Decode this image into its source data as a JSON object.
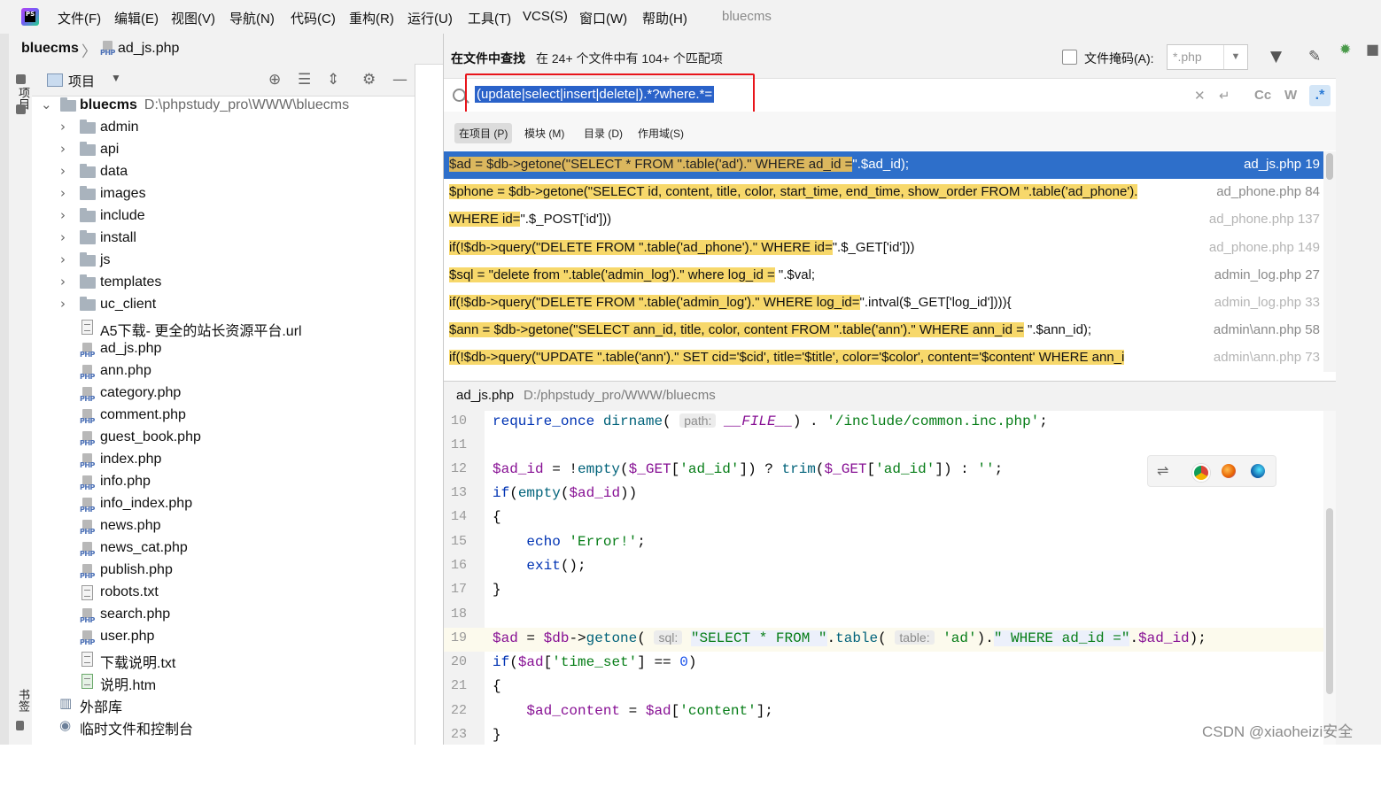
{
  "menubar": {
    "logo_text": "PS",
    "items": [
      "文件(F)",
      "编辑(E)",
      "视图(V)",
      "导航(N)",
      "代码(C)",
      "重构(R)",
      "运行(U)",
      "工具(T)",
      "VCS(S)",
      "窗口(W)",
      "帮助(H)"
    ],
    "window_title": "bluecms"
  },
  "navbar": {
    "root": "bluecms",
    "separator": "〉",
    "file": "ad_js.php"
  },
  "left_tools": {
    "project_tab": "项目",
    "bookmarks_tab": "书签"
  },
  "project": {
    "title": "项目",
    "root": {
      "name": "bluecms",
      "path": "D:\\phpstudy_pro\\WWW\\bluecms"
    },
    "folders": [
      "admin",
      "api",
      "data",
      "images",
      "include",
      "install",
      "js",
      "templates",
      "uc_client"
    ],
    "files": [
      {
        "name": "A5下载- 更全的站长资源平台.url",
        "type": "text"
      },
      {
        "name": "ad_js.php",
        "type": "php"
      },
      {
        "name": "ann.php",
        "type": "php"
      },
      {
        "name": "category.php",
        "type": "php"
      },
      {
        "name": "comment.php",
        "type": "php"
      },
      {
        "name": "guest_book.php",
        "type": "php"
      },
      {
        "name": "index.php",
        "type": "php"
      },
      {
        "name": "info.php",
        "type": "php"
      },
      {
        "name": "info_index.php",
        "type": "php"
      },
      {
        "name": "news.php",
        "type": "php"
      },
      {
        "name": "news_cat.php",
        "type": "php"
      },
      {
        "name": "publish.php",
        "type": "php"
      },
      {
        "name": "robots.txt",
        "type": "text"
      },
      {
        "name": "search.php",
        "type": "php"
      },
      {
        "name": "user.php",
        "type": "php"
      },
      {
        "name": "下载说明.txt",
        "type": "text"
      },
      {
        "name": "说明.htm",
        "type": "html"
      }
    ],
    "external_libs": "外部库",
    "scratches": "临时文件和控制台"
  },
  "find": {
    "title": "在文件中查找",
    "summary": "在 24+ 个文件中有 104+ 个匹配项",
    "file_mask_label": "文件掩码(A):",
    "file_mask_value": "*.php",
    "query": "(update|select|insert|delete|).*?where.*=",
    "option_case": "Cc",
    "option_word": "W",
    "option_regex": ".*",
    "scopes": [
      "在项目 (P)",
      "模块 (M)",
      "目录 (D)",
      "作用域(S)"
    ],
    "results": [
      {
        "hl": "$ad = $db->getone(\"SELECT * FROM \".table('ad').\" WHERE ad_id =",
        "rest": "\".$ad_id);",
        "loc": "ad_js.php 19"
      },
      {
        "hl": "$phone = $db->getone(\"SELECT id, content, title, color, start_time, end_time, show_order FROM \".table('ad_phone').",
        "rest": "",
        "loc": "ad_phone.php 84"
      },
      {
        "hl": " WHERE id=",
        "rest": "\".$_POST['id']))",
        "loc": "ad_phone.php 137"
      },
      {
        "hl": "if(!$db->query(\"DELETE FROM \".table('ad_phone').\" WHERE id=",
        "rest": "\".$_GET['id']))",
        "loc": "ad_phone.php 149"
      },
      {
        "hl": "$sql = \"delete from \".table('admin_log').\" where log_id =",
        "rest": " \".$val;",
        "loc": "admin_log.php 27"
      },
      {
        "hl": "if(!$db->query(\"DELETE FROM \".table('admin_log').\" WHERE log_id=",
        "rest": "\".intval($_GET['log_id']))){",
        "loc": "admin_log.php 33"
      },
      {
        "hl": "$ann = $db->getone(\"SELECT ann_id, title, color, content FROM \".table('ann').\" WHERE ann_id =",
        "rest": " \".$ann_id);",
        "loc": "admin\\ann.php 58"
      },
      {
        "hl": "if(!$db->query(\"UPDATE \".table('ann').\" SET cid='$cid', title='$title', color='$color', content='$content' WHERE ann_i",
        "rest": "",
        "loc": "admin\\ann.php 73"
      }
    ]
  },
  "preview": {
    "file": "ad_js.php",
    "path": "D:/phpstudy_pro/WWW/bluecms",
    "line_numbers": [
      "10",
      "11",
      "12",
      "13",
      "14",
      "15",
      "16",
      "17",
      "18",
      "19",
      "20",
      "21",
      "22",
      "23"
    ],
    "code": {
      "l10": {
        "kw1": "require_once",
        "fn1": "dirname",
        "p1": "(",
        "hint1": "path:",
        "c1": "__FILE__",
        "p2": ") . ",
        "s1": "'/include/common.inc.php'",
        "p3": ";"
      },
      "l12": {
        "v1": "$ad_id",
        "p1": " = !",
        "fn1": "empty",
        "p2": "(",
        "v2": "$_GET",
        "p3": "[",
        "s1": "'ad_id'",
        "p4": "]) ? ",
        "fn2": "trim",
        "p5": "(",
        "v3": "$_GET",
        "p6": "[",
        "s2": "'ad_id'",
        "p7": "]) : ",
        "s3": "''",
        "p8": ";"
      },
      "l13": {
        "kw1": "if",
        "p1": "(",
        "fn1": "empty",
        "p2": "(",
        "v1": "$ad_id",
        "p3": "))"
      },
      "l14": {
        "t": "{"
      },
      "l15": {
        "indent": "    ",
        "kw1": "echo",
        "p1": " ",
        "s1": "'Error!'",
        "p2": ";"
      },
      "l16": {
        "indent": "    ",
        "kw1": "exit",
        "p1": "();"
      },
      "l17": {
        "t": "}"
      },
      "l19": {
        "v1": "$ad",
        "p1": " = ",
        "v2": "$db",
        "p2": "->",
        "fn1": "getone",
        "p3": "(",
        "hint1": "sql:",
        "s1": "\"SELECT * FROM \"",
        "p4": ".",
        "fn2": "table",
        "p5": "(",
        "hint2": "table:",
        "s2": "'ad'",
        "p6": ").",
        "s3": "\" WHERE ad_id =\"",
        "p7": ".",
        "v3": "$ad_id",
        "p8": ");"
      },
      "l20": {
        "kw1": "if",
        "p1": "(",
        "v1": "$ad",
        "p2": "[",
        "s1": "'time_set'",
        "p3": "] == ",
        "n1": "0",
        "p4": ")"
      },
      "l21": {
        "t": "{"
      },
      "l22": {
        "indent": "    ",
        "v1": "$ad_content",
        "p1": " = ",
        "v2": "$ad",
        "p2": "[",
        "s1": "'content'",
        "p3": "];"
      },
      "l23": {
        "t": "}"
      }
    }
  },
  "watermark": "CSDN @xiaoheizi安全",
  "colors": {
    "selection": "#2e6fca",
    "match_highlight": "#f7d86b",
    "red_annotation": "#e8151b"
  }
}
